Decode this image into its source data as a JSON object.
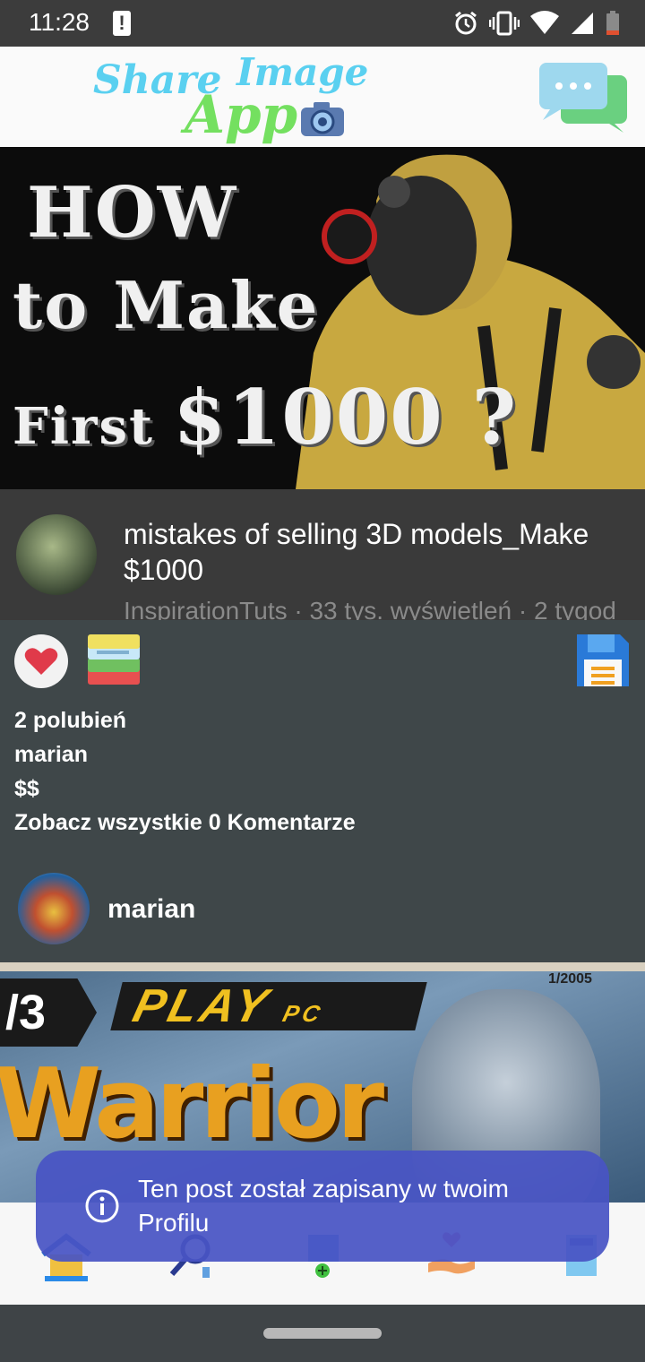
{
  "status_bar": {
    "time": "11:28",
    "alert_glyph": "!",
    "icons": [
      "alarm-icon",
      "vibrate-icon",
      "wifi-icon",
      "signal-icon",
      "battery-low-icon"
    ]
  },
  "header": {
    "logo_share": "Share",
    "logo_image": "Image",
    "logo_app": "App",
    "chat_icon": "chat-bubbles-icon"
  },
  "post1": {
    "thumbnail": {
      "line1": "HOW",
      "line2": "to Make",
      "line3_prefix": "First ",
      "line3_big": "$1000 ?"
    },
    "video_title": "mistakes of selling 3D models_Make $1000",
    "video_subtitle": "InspirationTuts · 33 tys. wyświetleń · 2 tygod",
    "likes": "2 polubień",
    "author": "marian",
    "caption": "$$",
    "comments_link": "Zobacz wszystkie 0 Komentarze",
    "comment_author": "marian"
  },
  "post2": {
    "number": "/3",
    "brand": "PLAY",
    "brand_sub": "PC",
    "issue": "1/2005",
    "title": "Warrior"
  },
  "bottom_nav": {
    "items": [
      "home-icon",
      "search-icon",
      "add-photo-icon",
      "activity-heart-icon",
      "profile-icon"
    ]
  },
  "toast": {
    "message": "Ten post został zapisany w twoim Profilu"
  },
  "colors": {
    "status_bar": "#3c3c3c",
    "panel": "#3f4749",
    "toast": "#4854c4",
    "logo_blue": "#5ad0f0",
    "logo_green": "#74e060"
  }
}
